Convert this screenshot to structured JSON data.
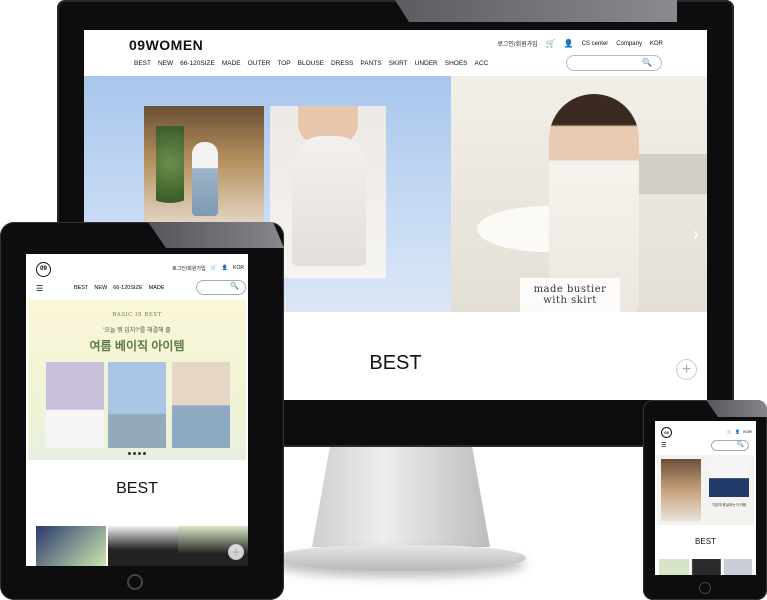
{
  "desktop": {
    "logo": "09WOMEN",
    "util": {
      "login": "로그인/회원가입",
      "cart_icon": "cart-icon",
      "user_icon": "user-icon",
      "cs": "CS center",
      "company": "Company",
      "lang": "KOR"
    },
    "nav": [
      "BEST",
      "NEW",
      "66-120SIZE",
      "MADE",
      "OUTER",
      "TOP",
      "BLOUSE",
      "DRESS",
      "PANTS",
      "SKIRT",
      "UNDER",
      "SHOES",
      "ACC"
    ],
    "search_icon": "search-icon",
    "hero_caption": [
      "made bustier",
      "with skirt"
    ],
    "best_title": "BEST",
    "plus": "+"
  },
  "tablet": {
    "logo": "09",
    "util": {
      "login": "로그인/회원가입",
      "lang": "KOR"
    },
    "nav": [
      "BEST",
      "NEW",
      "66-120SIZE",
      "MADE"
    ],
    "banner": {
      "badge": "BASIC IS BEST",
      "sub": "'오늘 뭐 입지?'를 해결해 줄",
      "headline": "여름 베이직 아이템"
    },
    "best_title": "BEST",
    "plus": "+"
  },
  "phone": {
    "logo": "09",
    "lang": "KOR",
    "caption": "기본에 충실하는 아이템",
    "best_title": "BEST"
  },
  "colors": {
    "accent_green": "#5b7a46",
    "device_frame": "#0d0d0f",
    "hero_sky": "#a8c6ec"
  }
}
